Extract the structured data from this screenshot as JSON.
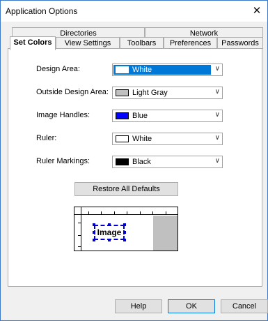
{
  "window": {
    "title": "Application Options",
    "close_glyph": "✕"
  },
  "tabs": {
    "back_row": [
      "Directories",
      "Network"
    ],
    "front_row": [
      "Set Colors",
      "View Settings",
      "Toolbars",
      "Preferences",
      "Passwords"
    ],
    "active": "Set Colors"
  },
  "set_colors": {
    "rows": [
      {
        "label": "Design Area:",
        "value": "White",
        "swatch": "#ffffff",
        "focused": true
      },
      {
        "label": "Outside Design Area:",
        "value": "Light Gray",
        "swatch": "#c0c0c0",
        "focused": false
      },
      {
        "label": "Image Handles:",
        "value": "Blue",
        "swatch": "#0000ff",
        "focused": false
      },
      {
        "label": "Ruler:",
        "value": "White",
        "swatch": "#ffffff",
        "focused": false
      },
      {
        "label": "Ruler Markings:",
        "value": "Black",
        "swatch": "#000000",
        "focused": false
      }
    ],
    "restore_label": "Restore All Defaults",
    "preview": {
      "image_label": "Image"
    }
  },
  "footer": {
    "help": "Help",
    "ok": "OK",
    "cancel": "Cancel"
  },
  "colors": {
    "accent": "#0078d7",
    "window_border": "#3c78c8",
    "handle": "#0000cc"
  }
}
